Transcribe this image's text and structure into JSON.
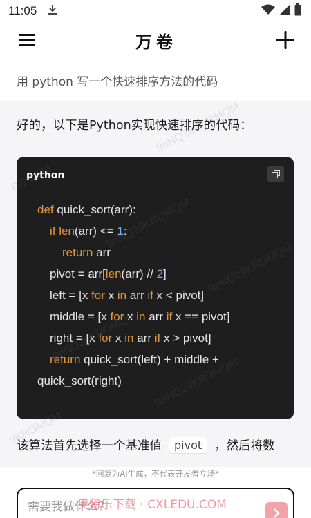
{
  "status_bar": {
    "time": "11:05",
    "icons": [
      "download-icon",
      "wifi-icon",
      "signal-icon",
      "battery-icon"
    ]
  },
  "header": {
    "title": "万卷",
    "menu_icon": "menu-icon",
    "add_icon": "plus-icon"
  },
  "user_prompt": "用 python 写一个快速排序方法的代码",
  "answer": {
    "intro": "好的，以下是Python实现快速排序的代码：",
    "code_block": {
      "language": "python",
      "copy_icon": "copy-icon",
      "lines": [
        "def quick_sort(arr):",
        "if len(arr) <= 1:",
        "return arr",
        "pivot = arr[len(arr) // 2]",
        "left = [x for x in arr if x < pivot]",
        "middle = [x for x in arr if x == pivot]",
        "right = [x for x in arr if x > pivot]",
        "return quick_sort(left) + middle +",
        "quick_sort(right)"
      ]
    },
    "text_before": "该算法首先选择一个基准值",
    "inline_code": "pivot",
    "text_after": "，然后将数"
  },
  "disclaimer": "*回复为AI生成，不代表开发者立场*",
  "input": {
    "placeholder": "需要我做什么？",
    "value": ""
  },
  "send_icon": "chevron-right-icon",
  "watermarks": [
    "9nNQ29KROMQM",
    "ROMQM",
    "9nNQ29KROMQM",
    "9nNQ29KROMQM",
    "9nNQ29KROMQM",
    "9KROMQM",
    "9nNQ29KROMQM"
  ],
  "site_watermark": "奥特乐下载 · CXLEDU.COM",
  "colors": {
    "code_bg": "#1e1e1e",
    "keyword": "#e5953f",
    "number": "#79b4e8",
    "answer_bg": "#f5f5f7",
    "send_button": "#f2a3a7"
  }
}
